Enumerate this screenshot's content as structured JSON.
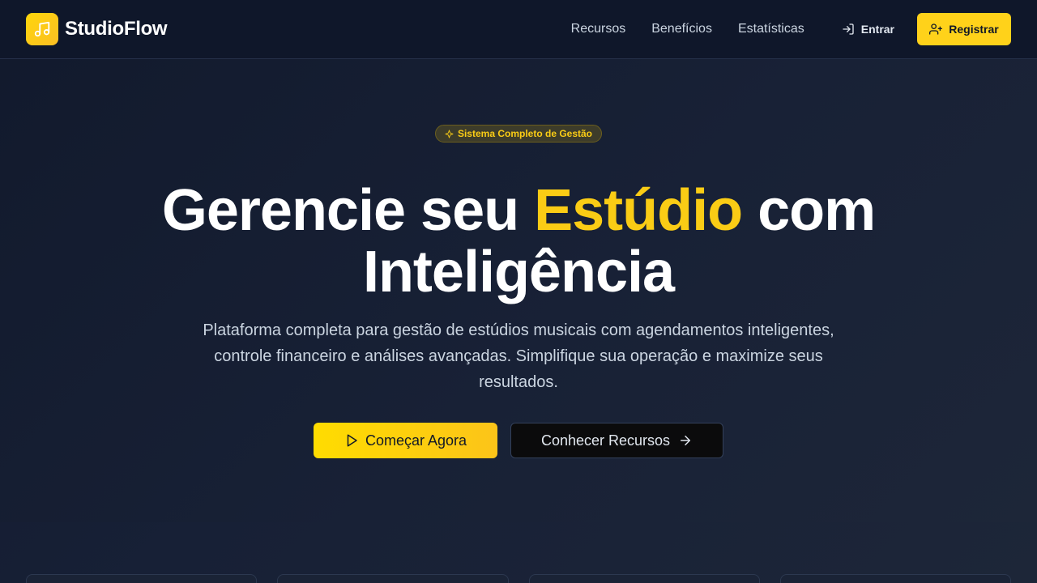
{
  "brand": {
    "name": "StudioFlow",
    "icon": "music-note-icon"
  },
  "nav": {
    "links": [
      "Recursos",
      "Benefícios",
      "Estatísticas"
    ],
    "login_label": "Entrar",
    "register_label": "Registrar"
  },
  "hero": {
    "badge": "Sistema Completo de Gestão",
    "headline_part1": "Gerencie seu ",
    "headline_accent": "Estúdio",
    "headline_part2": " com",
    "headline_line2": "Inteligência",
    "subtitle": "Plataforma completa para gestão de estúdios musicais com agendamentos inteligentes, controle financeiro e análises avançadas. Simplifique sua operação e maximize seus resultados.",
    "primary_cta": "Começar Agora",
    "secondary_cta": "Conhecer Recursos"
  },
  "colors": {
    "accent": "#facc15",
    "background": "#0f172a",
    "text_muted": "#cbd5e1"
  }
}
